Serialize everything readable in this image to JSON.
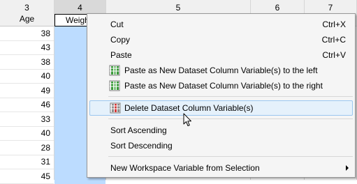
{
  "columns": [
    {
      "number": "3",
      "name": "Age",
      "values": [
        "38",
        "43",
        "38",
        "40",
        "49",
        "46",
        "33",
        "40",
        "28",
        "31",
        "45"
      ]
    },
    {
      "number": "4",
      "name": "Weight",
      "values": []
    },
    {
      "number": "5",
      "name": ""
    },
    {
      "number": "6",
      "name": ""
    },
    {
      "number": "7",
      "name": ""
    }
  ],
  "context_menu": {
    "items": [
      {
        "label": "Cut",
        "shortcut": "Ctrl+X"
      },
      {
        "label": "Copy",
        "shortcut": "Ctrl+C"
      },
      {
        "label": "Paste",
        "shortcut": "Ctrl+V"
      },
      {
        "label": "Paste as New Dataset Column Variable(s) to the left",
        "icon": "dataset-column-add-icon"
      },
      {
        "label": "Paste as New Dataset Column Variable(s) to the right",
        "icon": "dataset-column-add-icon"
      },
      {
        "label": "Delete Dataset Column Variable(s)",
        "icon": "dataset-column-delete-icon",
        "highlighted": true
      },
      {
        "label": "Sort Ascending"
      },
      {
        "label": "Sort Descending"
      },
      {
        "label": "New Workspace Variable from Selection",
        "submenu": true
      }
    ]
  },
  "cursor": "arrow-cursor-icon"
}
